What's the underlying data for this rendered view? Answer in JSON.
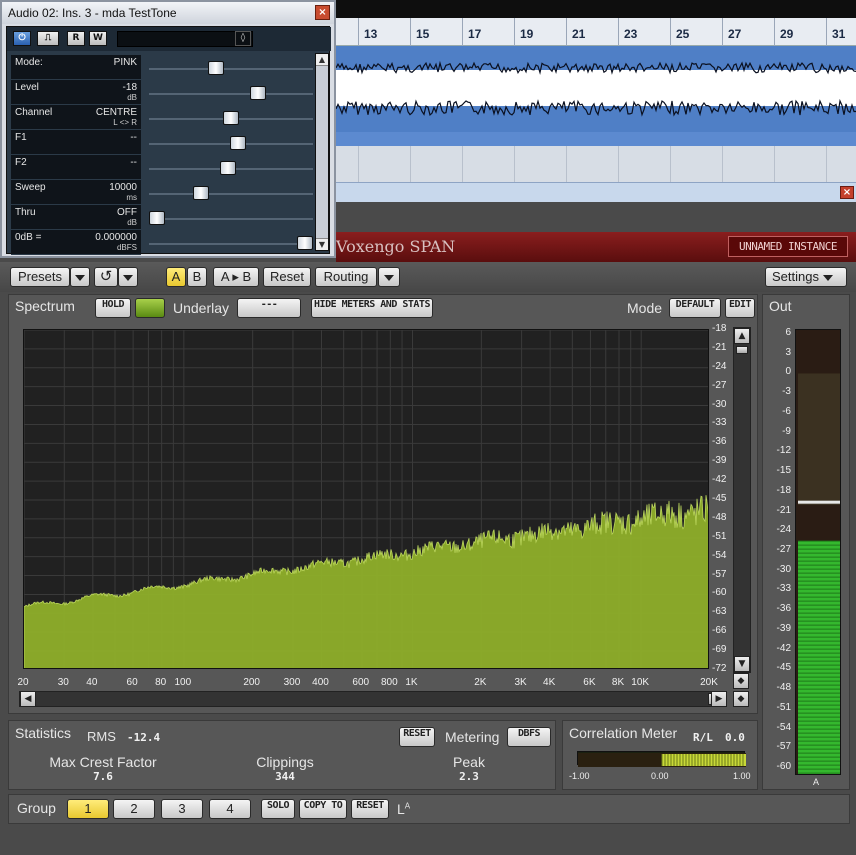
{
  "daw": {
    "ruler_numbers": [
      "13",
      "15",
      "17",
      "19",
      "21",
      "23",
      "25",
      "27",
      "29",
      "31"
    ]
  },
  "testtone": {
    "window_title": "Audio 02: Ins. 3 - mda TestTone",
    "close_glyph": "×",
    "toolbar": {
      "power": "⏻",
      "bypass": "⎍",
      "read": "R",
      "write": "W",
      "preset_arrow": "◊"
    },
    "params": [
      {
        "name": "Mode:",
        "value": "PINK",
        "unit": "",
        "level": 0.4
      },
      {
        "name": "Level",
        "value": "-18",
        "unit": "dB",
        "level": 0.68
      },
      {
        "name": "Channel",
        "value": "CENTRE",
        "unit": "L <> R",
        "level": 0.5
      },
      {
        "name": "F1",
        "value": "--",
        "unit": "",
        "level": 0.55
      },
      {
        "name": "F2",
        "value": "--",
        "unit": "",
        "level": 0.48
      },
      {
        "name": "Sweep",
        "value": "10000",
        "unit": "ms",
        "level": 0.3
      },
      {
        "name": "Thru",
        "value": "OFF",
        "unit": "dB",
        "level": 0.0
      },
      {
        "name": "0dB =",
        "value": "0.000000",
        "unit": "dBFS",
        "level": 1.0
      }
    ]
  },
  "span": {
    "close_glyph": "×",
    "title": "Voxengo SPAN",
    "instance_button": "UNNAMED INSTANCE",
    "toolbar": {
      "presets": "Presets",
      "undo_glyph": "↺",
      "a": "A",
      "b": "B",
      "a_to_b": "A ▸ B",
      "reset": "Reset",
      "routing": "Routing",
      "settings": "Settings"
    },
    "spectrum": {
      "label": "Spectrum",
      "hold": "HOLD",
      "underlay_label": "Underlay",
      "underlay_value": "---",
      "hide_meters": "HIDE METERS AND STATS",
      "mode_label": "Mode",
      "mode_default": "DEFAULT",
      "mode_edit": "EDIT",
      "up_glyph": "▲",
      "down_glyph": "▼",
      "left_glyph": "◀",
      "right_glyph": "▶",
      "diamond_glyph": "◆",
      "db_ticks": [
        "-18",
        "-21",
        "-24",
        "-27",
        "-30",
        "-33",
        "-36",
        "-39",
        "-42",
        "-45",
        "-48",
        "-51",
        "-54",
        "-57",
        "-60",
        "-63",
        "-66",
        "-69",
        "-72"
      ],
      "freq_ticks": [
        "20",
        "30",
        "40",
        "60",
        "80",
        "100",
        "200",
        "300",
        "400",
        "600",
        "800",
        "1K",
        "2K",
        "3K",
        "4K",
        "6K",
        "8K",
        "10K",
        "20K"
      ],
      "freq_values": [
        20,
        30,
        40,
        60,
        80,
        100,
        200,
        300,
        400,
        600,
        800,
        1000,
        2000,
        3000,
        4000,
        6000,
        8000,
        10000,
        20000
      ],
      "accent_color": "#8faf2a"
    },
    "out": {
      "label": "Out",
      "ticks": [
        "6",
        "3",
        "0",
        "-3",
        "-6",
        "-9",
        "-12",
        "-15",
        "-18",
        "-21",
        "-24",
        "-27",
        "-30",
        "-33",
        "-36",
        "-39",
        "-42",
        "-45",
        "-48",
        "-51",
        "-54",
        "-57",
        "-60"
      ],
      "channel": "A",
      "level_db": -25.5,
      "peak_db": -19.5
    },
    "stats": {
      "label": "Statistics",
      "rms_label": "RMS",
      "rms_value": "-12.4",
      "reset": "RESET",
      "metering_label": "Metering",
      "metering_value": "DBFS",
      "crest_label": "Max Crest Factor",
      "crest_value": "7.6",
      "clip_label": "Clippings",
      "clip_value": "344",
      "peak_label": "Peak",
      "peak_value": "2.3"
    },
    "correlation": {
      "label": "Correlation Meter",
      "rl_label": "R/L",
      "rl_value": "0.0",
      "scale": [
        "-1.00",
        "0.00",
        "1.00"
      ],
      "value": 0.0
    },
    "group": {
      "label": "Group",
      "buttons": [
        "1",
        "2",
        "3",
        "4"
      ],
      "active": "1",
      "solo": "SOLO",
      "copy_to": "COPY TO",
      "reset": "RESET",
      "routing_indicator": "L",
      "routing_sup": "A"
    }
  }
}
